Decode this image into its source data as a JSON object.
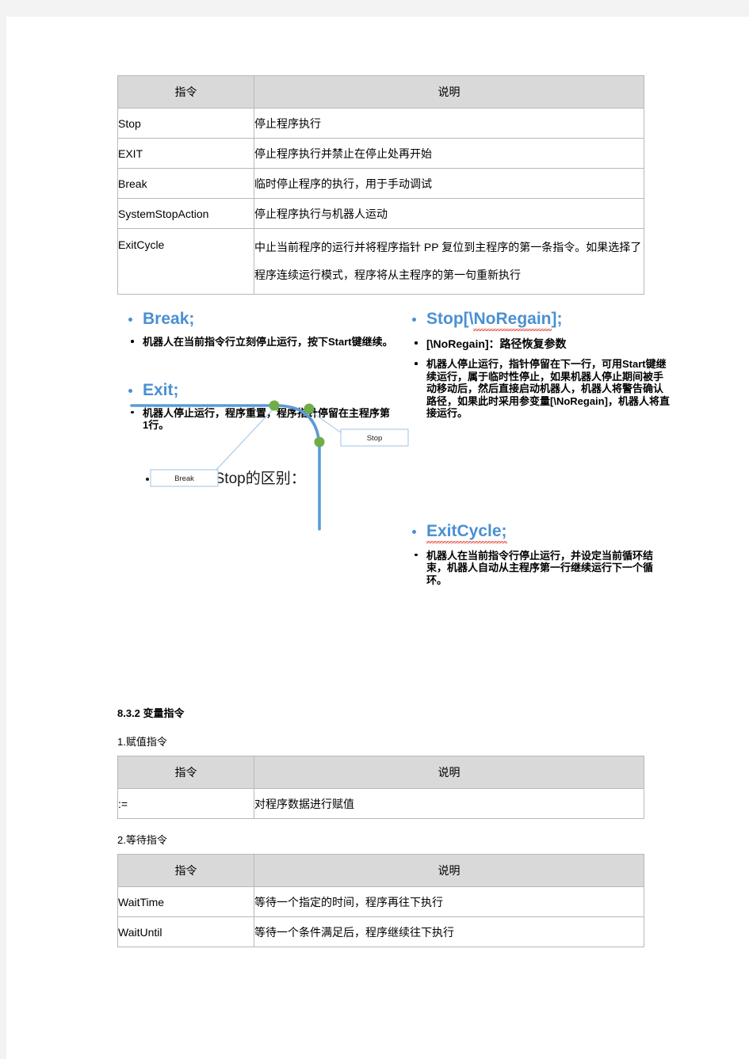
{
  "tables": {
    "stop_instructions": {
      "headers": [
        "指令",
        "说明"
      ],
      "rows": [
        {
          "cmd": "Stop",
          "desc": "停止程序执行"
        },
        {
          "cmd": "EXIT",
          "desc": "停止程序执行并禁止在停止处再开始"
        },
        {
          "cmd": "Break",
          "desc": "临时停止程序的执行，用于手动调试"
        },
        {
          "cmd": "SystemStopAction",
          "desc": "停止程序执行与机器人运动"
        },
        {
          "cmd": "ExitCycle",
          "desc": "中止当前程序的运行并将程序指针 PP 复位到主程序的第一条指令。如果选择了程序连续运行模式，程序将从主程序的第一句重新执行"
        }
      ]
    },
    "assign_instructions": {
      "headers": [
        "指令",
        "说明"
      ],
      "rows": [
        {
          "cmd": ":=",
          "desc": "对程序数据进行赋值"
        }
      ]
    },
    "wait_instructions": {
      "headers": [
        "指令",
        "说明"
      ],
      "rows": [
        {
          "cmd": "WaitTime",
          "desc": "等待一个指定的时间，程序再往下执行"
        },
        {
          "cmd": "WaitUntil",
          "desc": "等待一个条件满足后，程序继续往下执行"
        }
      ]
    }
  },
  "slide": {
    "break": {
      "heading": "Break;",
      "bullets": [
        "机器人在当前指令行立刻停止运行，按下Start键继续。"
      ]
    },
    "exit": {
      "heading": "Exit;",
      "bullets": [
        "机器人停止运行，程序重置，程序指针停留在主程序第1行。"
      ]
    },
    "stop": {
      "heading_prefix": "Stop[\\",
      "heading_spell": "NoRegain",
      "heading_suffix": "];",
      "bullets": [
        "[\\NoRegain]：路径恢复参数",
        "机器人停止运行，指针停留在下一行，可用Start键继续运行，属于临时性停止，如果机器人停止期间被手动移动后，然后直接启动机器人，机器人将警告确认路径，如果此时采用参变量[\\NoRegain]，机器人将直接运行。"
      ],
      "bullet_spell_word": "NoRegain"
    },
    "exitcycle": {
      "heading": "ExitCycle;",
      "bullets": [
        "机器人在当前指令行停止运行，并设定当前循环结束，机器人自动从主程序第一行继续运行下一个循环。"
      ]
    },
    "compare_heading": "Break和Stop的区别："
  },
  "diagram": {
    "callouts": [
      {
        "label": "Break"
      },
      {
        "label": "Stop"
      }
    ],
    "colors": {
      "path": "#5b9bd5",
      "dot": "#70ad47",
      "callout_border": "#9dc3e6",
      "leader": "#9dc3e6"
    }
  },
  "lower": {
    "section_heading": "8.3.2 变量指令",
    "label_assign": "1.赋值指令",
    "label_wait": "2.等待指令"
  },
  "colors": {
    "heading_blue": "#4a90d2",
    "table_header_bg": "#d9d9d9",
    "table_border": "#b8b8b8",
    "spell_underline": "#e03b2f",
    "page_bg": "#ffffff",
    "canvas_bg": "#f3f3f3"
  }
}
